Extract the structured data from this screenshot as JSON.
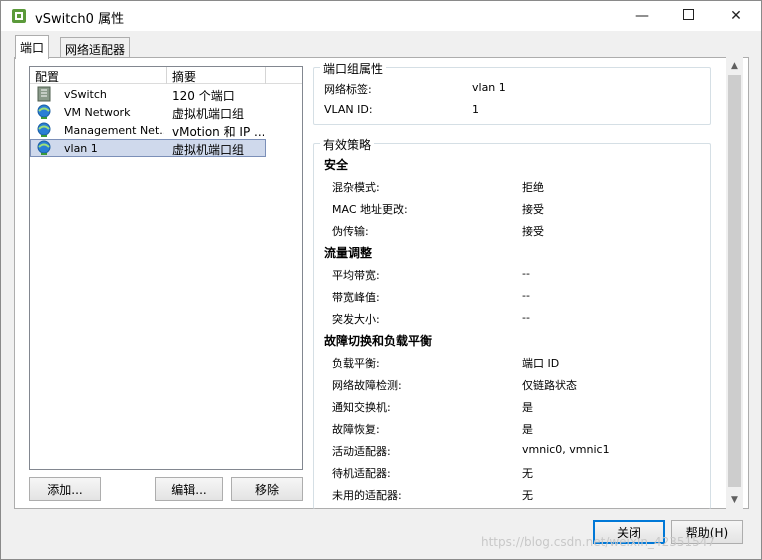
{
  "window": {
    "title": "vSwitch0 属性"
  },
  "tabs": [
    {
      "label": "端口"
    },
    {
      "label": "网络适配器"
    }
  ],
  "list": {
    "headers": [
      "配置",
      "摘要"
    ],
    "rows": [
      {
        "name": "vSwitch",
        "summary": "120 个端口",
        "icon": "switch-icon"
      },
      {
        "name": "VM Network",
        "summary": "虚拟机端口组",
        "icon": "globe-icon"
      },
      {
        "name": "Management Net...",
        "summary": "vMotion 和 IP ...",
        "icon": "globe-icon"
      },
      {
        "name": "vlan 1",
        "summary": "虚拟机端口组",
        "icon": "globe-icon",
        "selected": true
      }
    ]
  },
  "buttons": {
    "add": "添加...",
    "edit": "编辑...",
    "remove": "移除",
    "close": "关闭",
    "help": "帮助(H)"
  },
  "portgroup_props": {
    "title": "端口组属性",
    "rows": [
      {
        "label": "网络标签:",
        "value": "vlan 1"
      },
      {
        "label": "VLAN ID:",
        "value": "1"
      }
    ]
  },
  "policies": {
    "title": "有效策略",
    "sections": [
      {
        "heading": "安全",
        "rows": [
          {
            "label": "混杂模式:",
            "value": "拒绝"
          },
          {
            "label": "MAC 地址更改:",
            "value": "接受"
          },
          {
            "label": "伪传输:",
            "value": "接受"
          }
        ]
      },
      {
        "heading": "流量调整",
        "rows": [
          {
            "label": "平均带宽:",
            "value": "--"
          },
          {
            "label": "带宽峰值:",
            "value": "--"
          },
          {
            "label": "突发大小:",
            "value": "--"
          }
        ]
      },
      {
        "heading": "故障切换和负载平衡",
        "rows": [
          {
            "label": "负载平衡:",
            "value": "端口 ID"
          },
          {
            "label": "网络故障检测:",
            "value": "仅链路状态"
          },
          {
            "label": "通知交换机:",
            "value": "是"
          },
          {
            "label": "故障恢复:",
            "value": "是"
          },
          {
            "label": "活动适配器:",
            "value": "vmnic0, vmnic1"
          },
          {
            "label": "待机适配器:",
            "value": "无"
          },
          {
            "label": "未用的适配器:",
            "value": "无"
          }
        ]
      }
    ]
  },
  "watermark": "https://blog.csdn.net/weixin_42351547",
  "colors": {
    "selection": "#cfd9ec",
    "accent": "#0078d7"
  }
}
